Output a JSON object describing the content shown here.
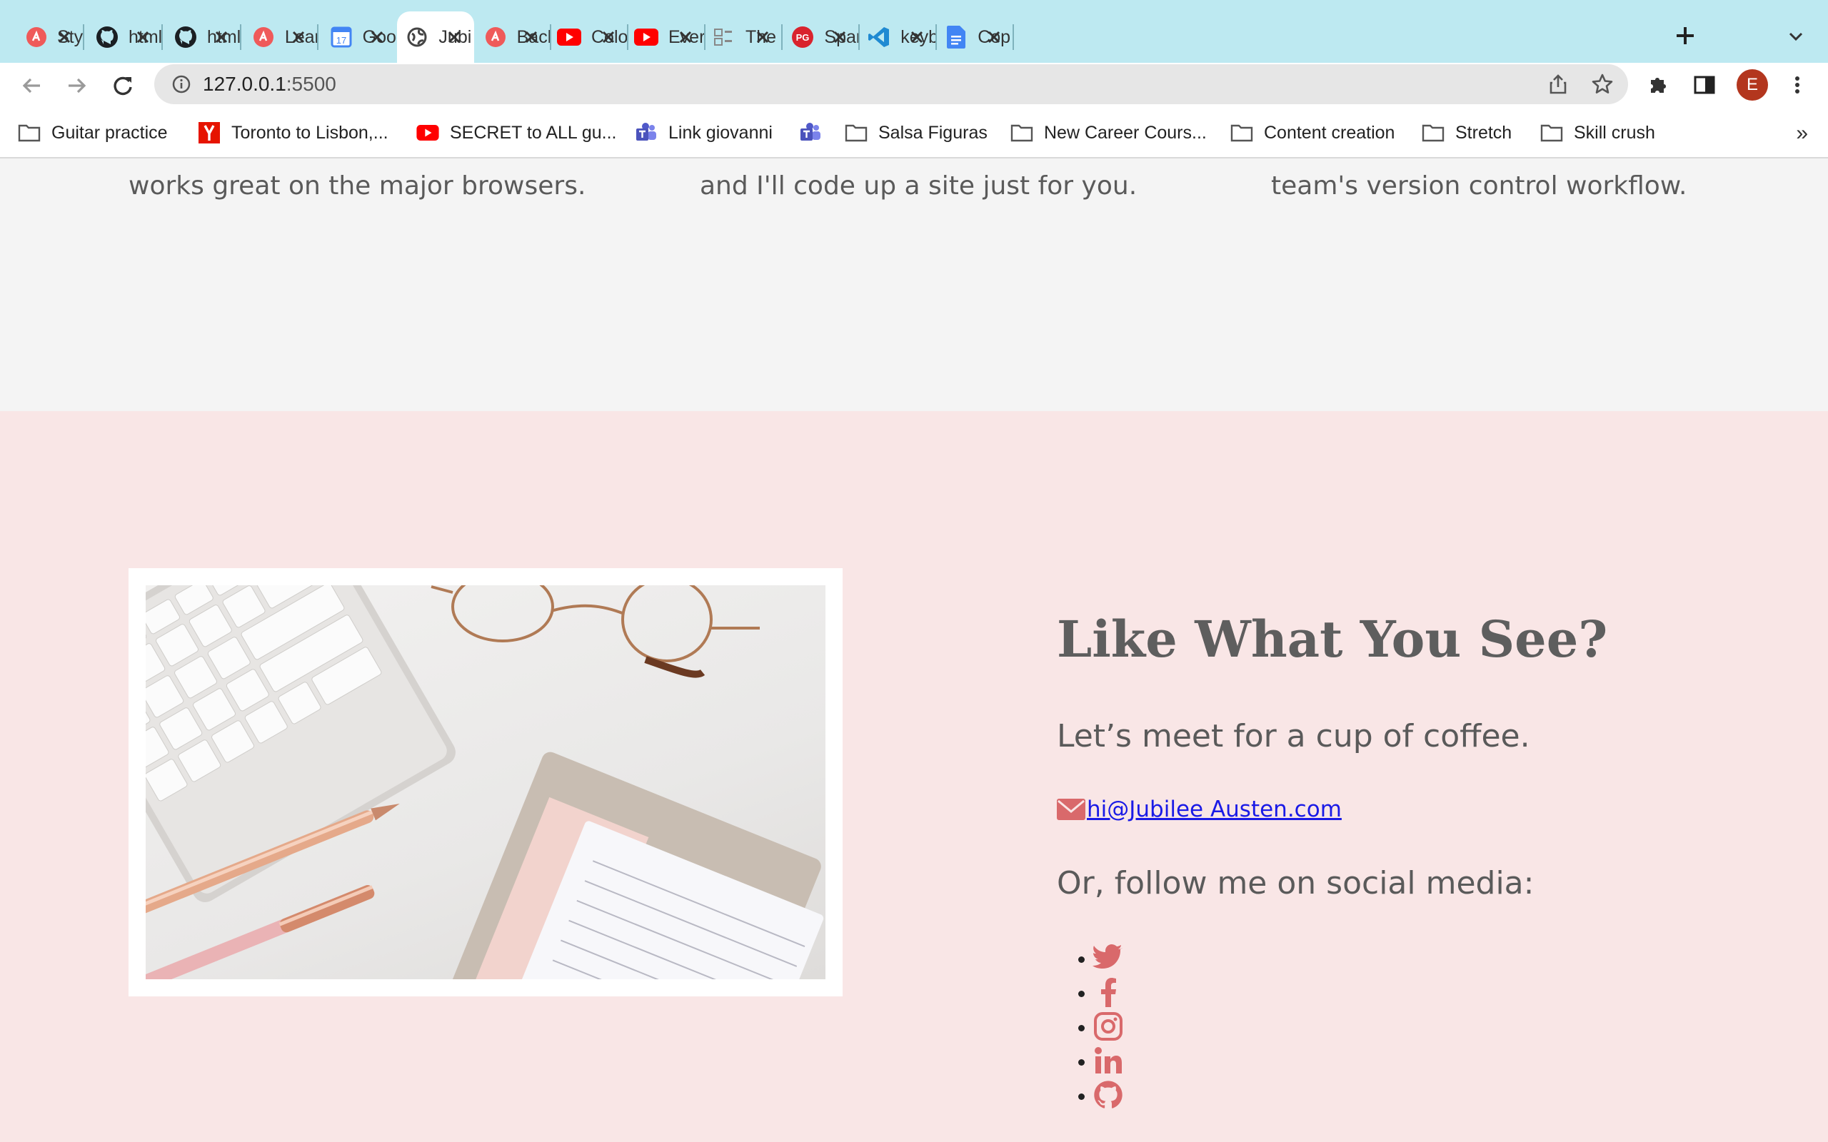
{
  "browser": {
    "tabs": [
      {
        "title": "Style",
        "icon": "skillcrush-icon"
      },
      {
        "title": "html",
        "icon": "github-icon"
      },
      {
        "title": "html",
        "icon": "github-icon"
      },
      {
        "title": "Lear",
        "icon": "skillcrush-icon"
      },
      {
        "title": "Goog",
        "icon": "calendar-icon"
      },
      {
        "title": "Jubi",
        "icon": "globe-icon",
        "active": true
      },
      {
        "title": "Back",
        "icon": "skillcrush-icon"
      },
      {
        "title": "Colo",
        "icon": "youtube-icon"
      },
      {
        "title": "Ever",
        "icon": "youtube-icon"
      },
      {
        "title": "The",
        "icon": "generic-page-icon"
      },
      {
        "title": "Spar",
        "icon": "pg-icon"
      },
      {
        "title": "keyb",
        "icon": "vscode-icon"
      },
      {
        "title": "Cop",
        "icon": "docs-icon"
      }
    ],
    "url_host": "127.0.0.1",
    "url_port": ":5500",
    "profile_initial": "E",
    "bookmarks": [
      {
        "label": "Guitar practice",
        "icon": "folder-icon"
      },
      {
        "label": "Toronto to Lisbon,...",
        "icon": "yandex-icon"
      },
      {
        "label": "SECRET to ALL gu...",
        "icon": "youtube-icon"
      },
      {
        "label": "Link giovanni",
        "icon": "teams-icon"
      },
      {
        "label": "",
        "icon": "teams-icon"
      },
      {
        "label": "Salsa Figuras",
        "icon": "folder-icon"
      },
      {
        "label": "New Career Cours...",
        "icon": "folder-icon"
      },
      {
        "label": "Content creation",
        "icon": "folder-icon"
      },
      {
        "label": "Stretch",
        "icon": "folder-icon"
      },
      {
        "label": "Skill crush",
        "icon": "folder-icon"
      }
    ],
    "bookmarks_overflow": "»"
  },
  "page": {
    "features": [
      "works great on the major browsers.",
      "and I'll code up a site just for you.",
      "team's version control workflow."
    ],
    "contact": {
      "heading": "Like What You See?",
      "subheading": "Let’s meet for a cup of coffee.",
      "email": "hi@Jubilee Austen.com",
      "follow": "Or, follow me on social media:",
      "social": [
        "twitter-icon",
        "facebook-icon",
        "instagram-icon",
        "linkedin-icon",
        "github-icon"
      ]
    }
  },
  "colors": {
    "tabbar": "#bde9f1",
    "features_bg": "#f4f4f4",
    "contact_bg": "#f9e6e6",
    "accent": "#d9696b",
    "link": "#1a1ae6"
  }
}
